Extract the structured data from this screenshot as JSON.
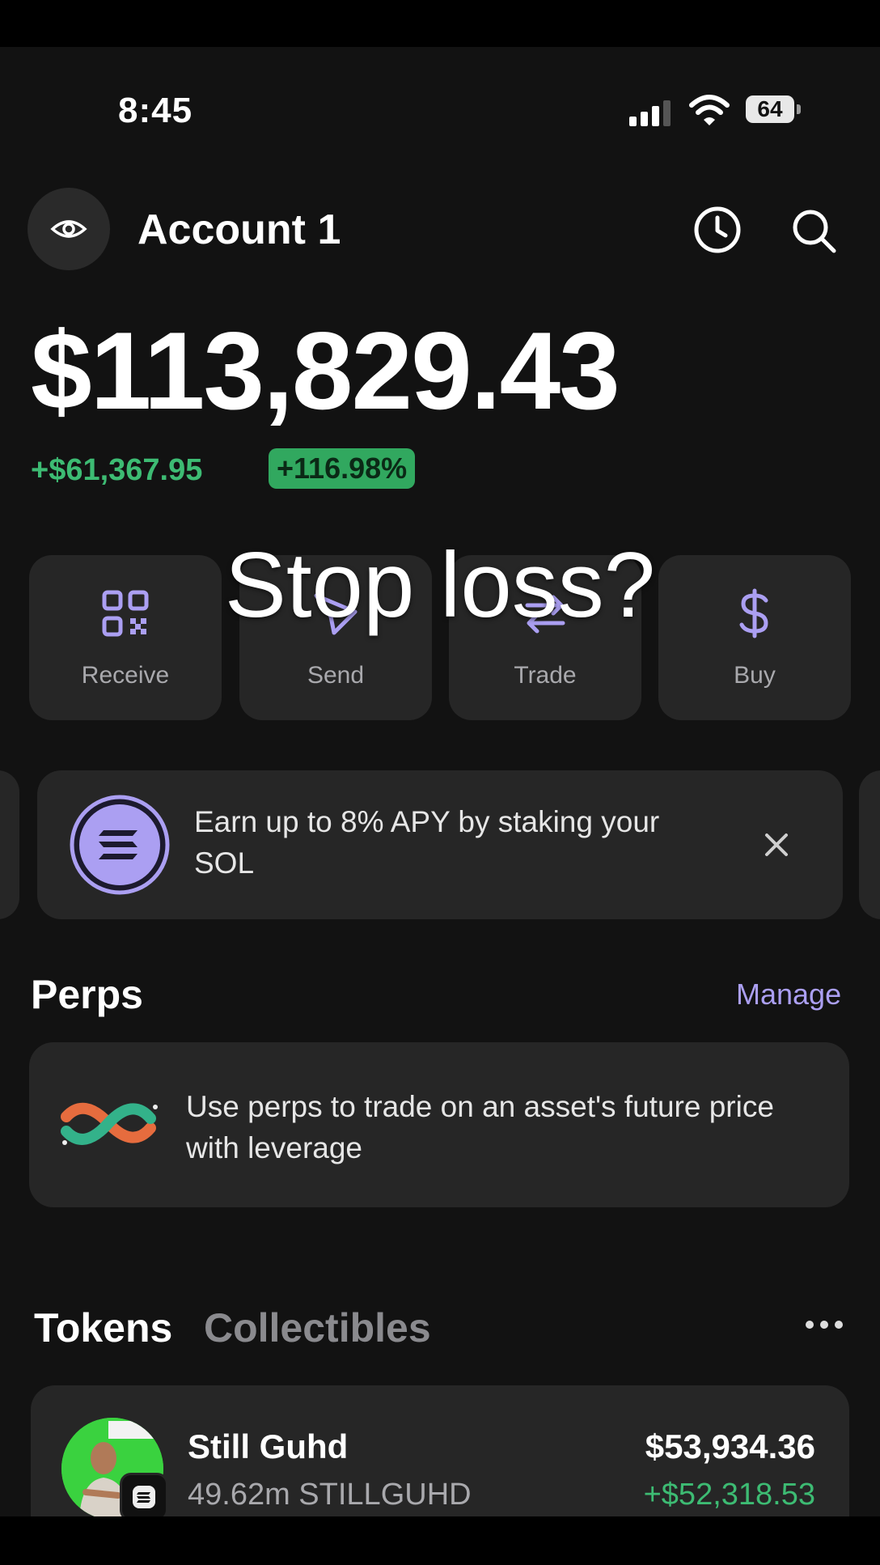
{
  "status_bar": {
    "time": "8:45",
    "battery": "64"
  },
  "header": {
    "account_name": "Account 1"
  },
  "balance": {
    "total": "$113,829.43",
    "change_amount": "+$61,367.95",
    "change_percent": "+116.98%"
  },
  "actions": [
    {
      "label": "Receive",
      "icon": "qr-code-icon"
    },
    {
      "label": "Send",
      "icon": "send-icon"
    },
    {
      "label": "Trade",
      "icon": "swap-icon"
    },
    {
      "label": "Buy",
      "icon": "dollar-icon"
    }
  ],
  "overlay_caption": "Stop loss?",
  "promo": {
    "text": "Earn up to 8% APY by staking your SOL"
  },
  "perps": {
    "title": "Perps",
    "manage_label": "Manage",
    "description": "Use perps to trade on an asset's future price with leverage"
  },
  "tabs": {
    "tokens": "Tokens",
    "collectibles": "Collectibles"
  },
  "tokens": [
    {
      "name": "Still Guhd",
      "amount": "49.62m STILLGUHD",
      "value": "$53,934.36",
      "change": "+$52,318.53"
    }
  ],
  "colors": {
    "accent_purple": "#ab9ff2",
    "positive_green": "#3dbb73",
    "card_bg": "#262626",
    "screen_bg": "#121212"
  }
}
